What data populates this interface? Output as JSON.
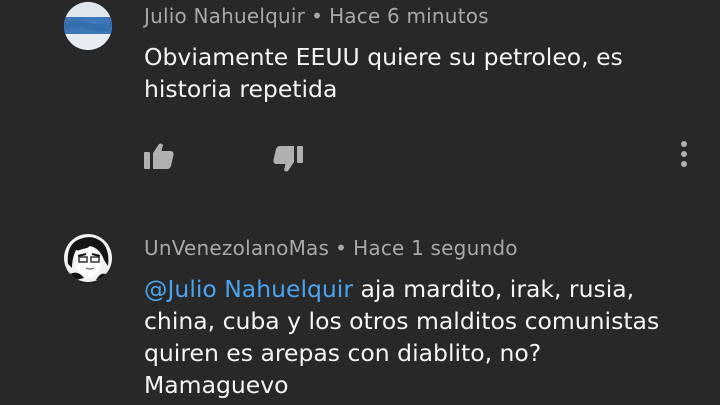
{
  "comments": [
    {
      "author": "Julio Nahuelquir",
      "separator": "•",
      "time": "Hace 6 minutos",
      "text": "Obviamente EEUU quiere su petroleo, es historia repetida",
      "avatar": "avatar-flag-light-blue"
    },
    {
      "author": "UnVenezolanoMas",
      "separator": "•",
      "time": "Hace 1 segundo",
      "mention": "@Julio Nahuelquir",
      "text": " aja mardito, irak, rusia, china, cuba y los otros malditos comunistas quiren es arepas con diablito, no? Mamaguevo",
      "avatar": "avatar-anime-character"
    }
  ],
  "actions": {
    "like_icon": "thumb-up-icon",
    "dislike_icon": "thumb-down-icon",
    "more_icon": "more-vertical-icon"
  },
  "colors": {
    "background": "#282828",
    "meta": "#a8a8a8",
    "text": "#f4f4f4",
    "mention": "#4aa3f0",
    "icon": "#b0b0b0"
  }
}
